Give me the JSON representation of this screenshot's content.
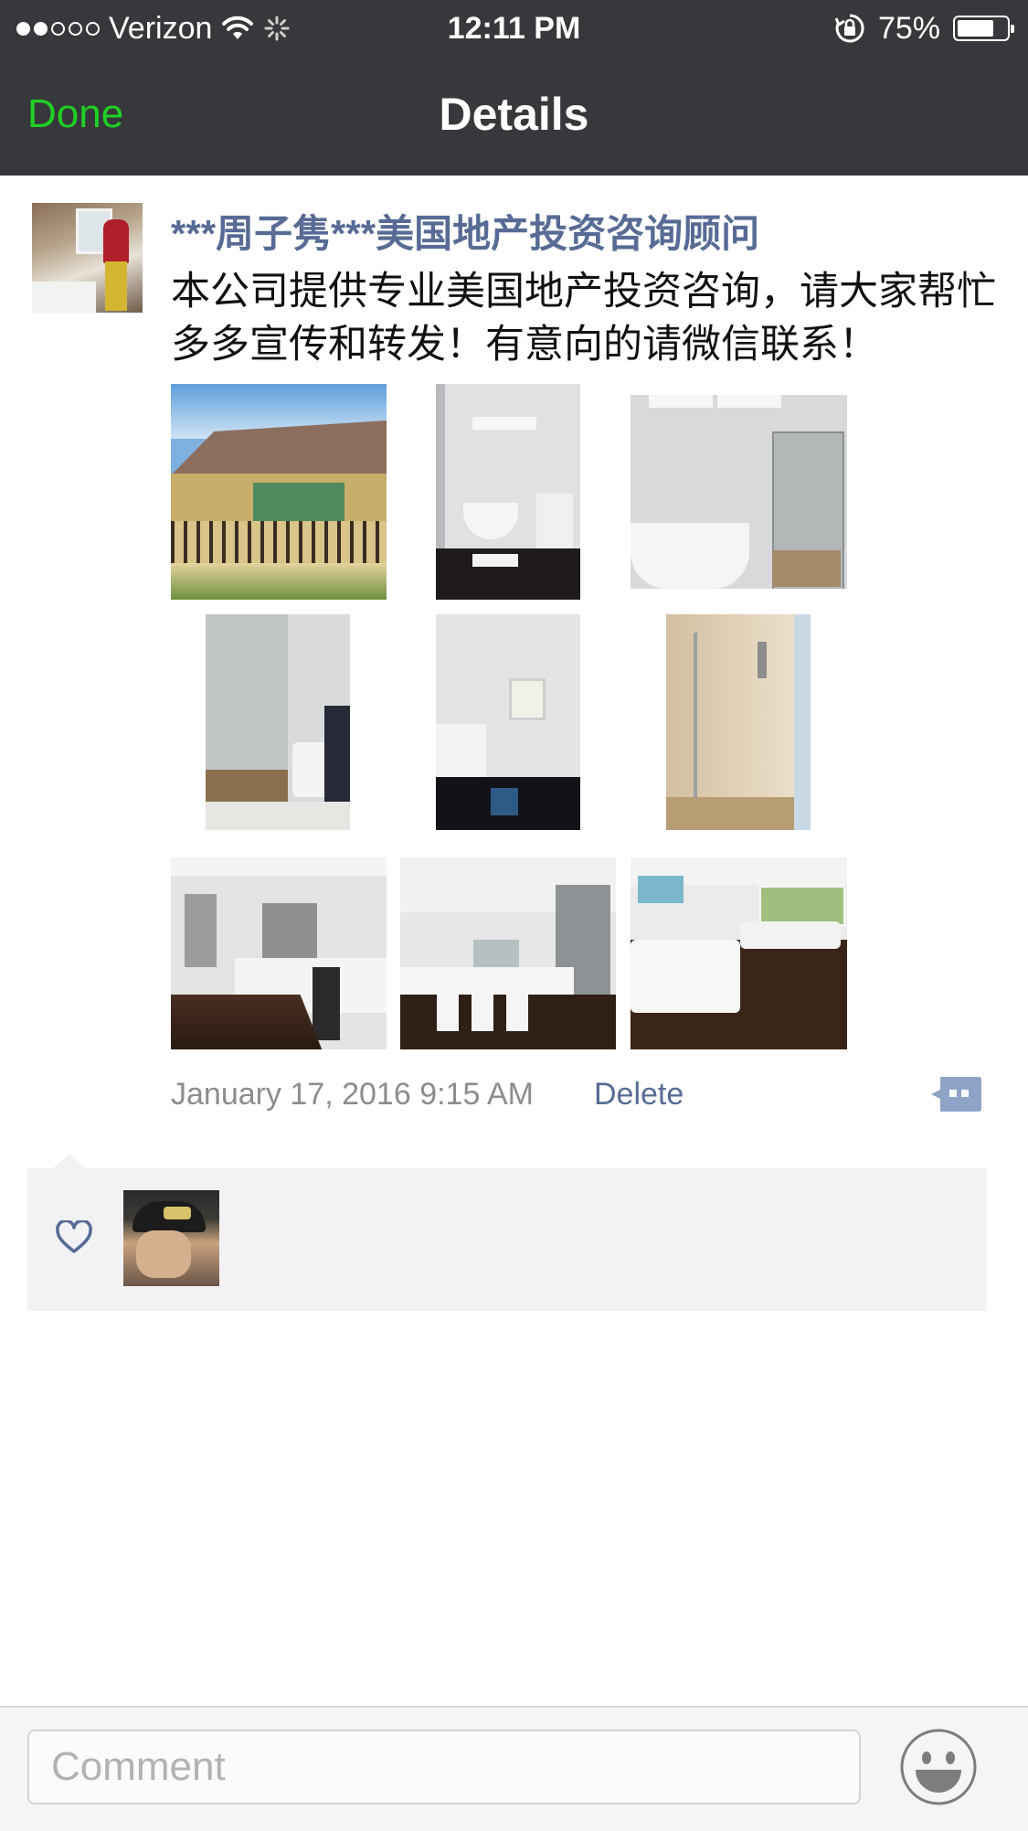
{
  "status_bar": {
    "carrier": "Verizon",
    "time": "12:11 PM",
    "battery_text": "75%",
    "battery_level": 0.75,
    "signal_bars_filled": 2,
    "signal_bars_total": 5
  },
  "nav": {
    "done_label": "Done",
    "title": "Details"
  },
  "post": {
    "author": "***周子隽***美国地产投资咨询顾问",
    "text": "本公司提供专业美国地产投资咨询，请大家帮忙多多宣传和转发！有意向的请微信联系！",
    "timestamp": "January 17, 2016 9:15 AM",
    "delete_label": "Delete",
    "photo_count": 9
  },
  "colors": {
    "nav_background": "#37383b",
    "done_green": "#1fd024",
    "link_blue": "#576b95",
    "likes_background": "#f2f2f4"
  },
  "comment_bar": {
    "placeholder": "Comment"
  }
}
